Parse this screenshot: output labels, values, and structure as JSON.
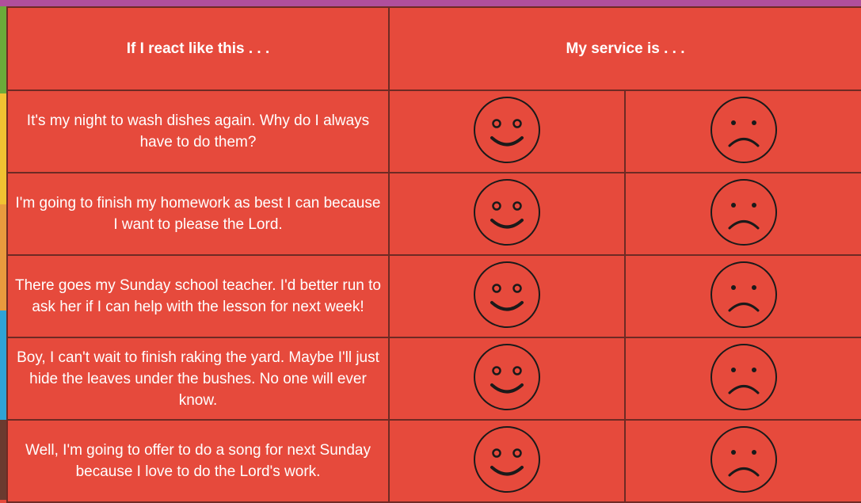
{
  "header": {
    "col_reaction": "If I react like this . . .",
    "col_service": "My service is . . ."
  },
  "rows": [
    {
      "text": "It's my night to wash dishes again. Why do I always have to do them?"
    },
    {
      "text": "I'm going to finish my homework as best I can because I want to please the Lord."
    },
    {
      "text": "There goes my Sunday school teacher. I'd better run to ask her if I can help with the lesson for next week!"
    },
    {
      "text": "Boy, I can't wait to finish raking the yard. Maybe I'll just hide the leaves under the bushes. No one will ever know."
    },
    {
      "text": "Well, I'm going to offer to do a song for next Sunday because I love to do the Lord's work."
    }
  ],
  "icons": {
    "happy": "smiley-face-icon",
    "sad": "frowning-face-icon"
  },
  "colors": {
    "background": "#e64a3c",
    "border": "#6e2a24",
    "text": "#ffffff",
    "top_bar": "#b04f9c"
  }
}
